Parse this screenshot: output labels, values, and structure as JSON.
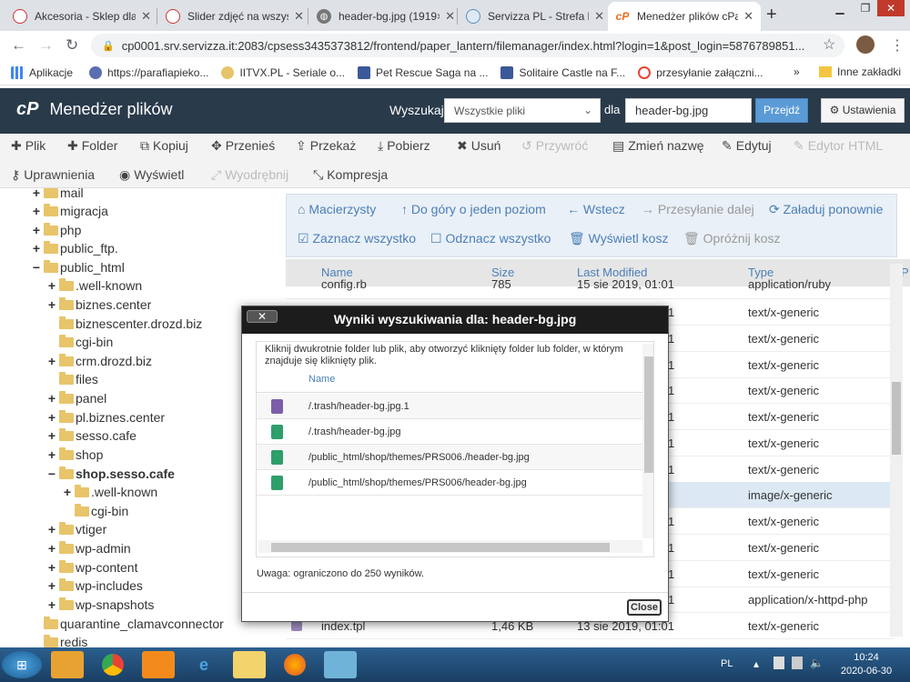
{
  "browser": {
    "tabs": [
      {
        "title": "Akcesoria - Sklep dla",
        "color": "#c33"
      },
      {
        "title": "Slider zdjęć na wszys",
        "color": "#c33"
      },
      {
        "title": "header-bg.jpg (1919×",
        "color": "#666"
      },
      {
        "title": "Servizza PL - Strefa k",
        "color": "#5a8fc0"
      },
      {
        "title": "Menedżer plików cPa",
        "color": "#f26b21"
      }
    ],
    "new_tab": "+",
    "url": "cp0001.srv.servizza.it:2083/cpsess3435373812/frontend/paper_lantern/filemanager/index.html?login=1&post_login=5876789851...",
    "bookmarks": [
      "Aplikacje",
      "https://parafiapieko...",
      "IITVX.PL - Seriale o...",
      "Pet Rescue Saga na ...",
      "Solitaire Castle na F...",
      "przesyłanie załączni..."
    ],
    "bookmarks_more": "»",
    "other_bookmarks": "Inne zakładki"
  },
  "header": {
    "logo": "cP",
    "title": "Menedżer plików",
    "search_label": "Wyszukaj",
    "search_scope": "Wszystkie pliki",
    "for_label": "dla",
    "search_value": "header-bg.jpg",
    "go": "Przejdź",
    "settings": "Ustawienia"
  },
  "toolbar": {
    "row1": [
      "Plik",
      "Folder",
      "Kopiuj",
      "Przenieś",
      "Przekaż",
      "Pobierz",
      "Usuń",
      "Przywróć",
      "Zmień nazwę",
      "Edytuj",
      "Edytor HTML"
    ],
    "row2": [
      "Uprawnienia",
      "Wyświetl",
      "Wyodrębnij",
      "Kompresja"
    ]
  },
  "tree": [
    {
      "label": "mail",
      "pm": "+"
    },
    {
      "label": "migracja",
      "pm": "+"
    },
    {
      "label": "php",
      "pm": "+"
    },
    {
      "label": "public_ftp.",
      "pm": "+"
    },
    {
      "label": "public_html",
      "pm": "−"
    },
    {
      "label": ".well-known",
      "pm": "+"
    },
    {
      "label": "biznes.center",
      "pm": "+"
    },
    {
      "label": "biznescenter.drozd.biz",
      "pm": ""
    },
    {
      "label": "cgi-bin",
      "pm": ""
    },
    {
      "label": "crm.drozd.biz",
      "pm": "+"
    },
    {
      "label": "files",
      "pm": ""
    },
    {
      "label": "panel",
      "pm": "+"
    },
    {
      "label": "pl.biznes.center",
      "pm": "+"
    },
    {
      "label": "sesso.cafe",
      "pm": "+"
    },
    {
      "label": "shop",
      "pm": "+"
    },
    {
      "label": "shop.sesso.cafe",
      "pm": "−"
    },
    {
      "label": ".well-known",
      "pm": "+"
    },
    {
      "label": "cgi-bin",
      "pm": ""
    },
    {
      "label": "vtiger",
      "pm": "+"
    },
    {
      "label": "wp-admin",
      "pm": "+"
    },
    {
      "label": "wp-content",
      "pm": "+"
    },
    {
      "label": "wp-includes",
      "pm": "+"
    },
    {
      "label": "wp-snapshots",
      "pm": "+"
    },
    {
      "label": "quarantine_clamavconnector",
      "pm": ""
    },
    {
      "label": "redis",
      "pm": ""
    }
  ],
  "nav": {
    "home": "Macierzysty",
    "up": "Do góry o jeden poziom",
    "back": "Wstecz",
    "forward": "Przesyłanie dalej",
    "reload": "Załaduj ponownie",
    "select_all": "Zaznacz wszystko",
    "deselect_all": "Odznacz wszystko",
    "view_trash": "Wyświetl kosz",
    "empty_trash": "Opróżnij kosz"
  },
  "table": {
    "columns": [
      "Name",
      "Size",
      "Last Modified",
      "Type",
      "P"
    ],
    "rows": [
      {
        "name": "config.rb",
        "size": "785",
        "modified": "15 sie 2019, 01:01",
        "type": "application/ruby"
      },
      {
        "name": "",
        "size": "",
        "modified": "1",
        "type": "text/x-generic"
      },
      {
        "name": "",
        "size": "",
        "modified": "1",
        "type": "text/x-generic"
      },
      {
        "name": "",
        "size": "",
        "modified": "1",
        "type": "text/x-generic"
      },
      {
        "name": "",
        "size": "",
        "modified": "1",
        "type": "text/x-generic"
      },
      {
        "name": "",
        "size": "",
        "modified": "1",
        "type": "text/x-generic"
      },
      {
        "name": "",
        "size": "",
        "modified": "1",
        "type": "text/x-generic"
      },
      {
        "name": "",
        "size": "",
        "modified": "1",
        "type": "text/x-generic"
      },
      {
        "name": "",
        "size": "",
        "modified": "",
        "type": "image/x-generic"
      },
      {
        "name": "",
        "size": "",
        "modified": "1",
        "type": "text/x-generic"
      },
      {
        "name": "",
        "size": "",
        "modified": "1",
        "type": "text/x-generic"
      },
      {
        "name": "",
        "size": "",
        "modified": "1",
        "type": "text/x-generic"
      },
      {
        "name": "",
        "size": "",
        "modified": "1",
        "type": "application/x-httpd-php"
      },
      {
        "name": "index.tpl",
        "size": "1,46 KB",
        "modified": "13 sie 2019, 01:01",
        "type": "text/x-generic"
      }
    ]
  },
  "modal": {
    "close_x": "✕",
    "title": "Wyniki wyszukiwania dla: header-bg.jpg",
    "description": "Kliknij dwukrotnie folder lub plik, aby otworzyć kliknięty folder lub folder, w którym znajduje się kliknięty plik.",
    "column": "Name",
    "results": [
      {
        "path": "/.trash/header-bg.jpg.1",
        "icon": "file-icon",
        "color": "#7b5ea7"
      },
      {
        "path": "/.trash/header-bg.jpg",
        "icon": "image-file-icon",
        "color": "#2e9e6b"
      },
      {
        "path": "/public_html/shop/themes/PRS006./header-bg.jpg",
        "icon": "image-file-icon",
        "color": "#2e9e6b"
      },
      {
        "path": "/public_html/shop/themes/PRS006/header-bg.jpg",
        "icon": "image-file-icon",
        "color": "#2e9e6b"
      }
    ],
    "note": "Uwaga: ograniczono do 250 wyników.",
    "close": "Close"
  },
  "taskbar": {
    "lang": "PL",
    "time": "10:24",
    "date": "2020-06-30"
  }
}
